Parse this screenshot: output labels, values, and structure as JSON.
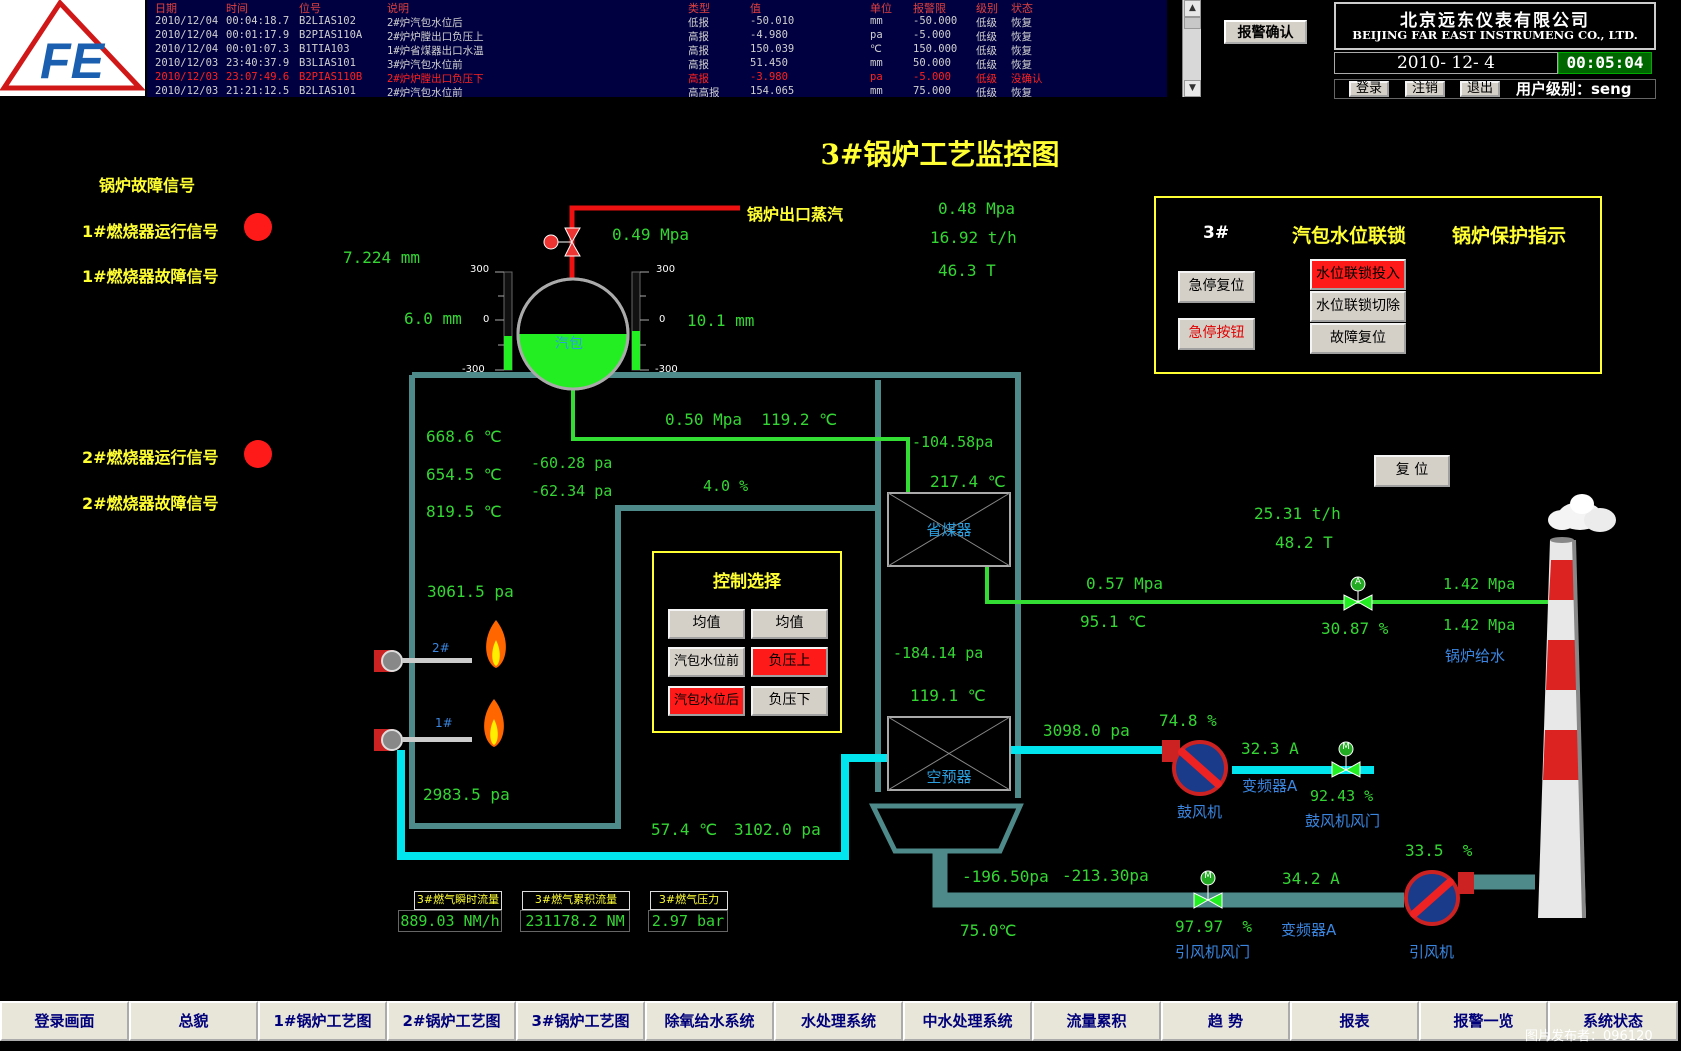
{
  "header": {
    "logo_text": "FE",
    "alarm_columns": [
      "日期",
      "时间",
      "位号",
      "说明",
      "类型",
      "值",
      "单位",
      "报警限",
      "级别",
      "状态"
    ],
    "alarm_rows": [
      {
        "date": "2010/12/04",
        "time": "00:04:18.7",
        "tag": "B2LIAS102",
        "desc": "2#炉汽包水位后",
        "type": "低报",
        "value": "-50.010",
        "unit": "mm",
        "limit": "-50.000",
        "level": "低级",
        "status": "恢复",
        "color": "#d0d0d0"
      },
      {
        "date": "2010/12/04",
        "time": "00:01:17.9",
        "tag": "B2PIAS110A",
        "desc": "2#炉炉膛出口负压上",
        "type": "高报",
        "value": "-4.980",
        "unit": "pa",
        "limit": "-5.000",
        "level": "低级",
        "status": "恢复",
        "color": "#d0d0d0"
      },
      {
        "date": "2010/12/04",
        "time": "00:01:07.3",
        "tag": "B1TIA103",
        "desc": "1#炉省煤器出口水温",
        "type": "高报",
        "value": "150.039",
        "unit": "℃",
        "limit": "150.000",
        "level": "低级",
        "status": "恢复",
        "color": "#d0d0d0"
      },
      {
        "date": "2010/12/03",
        "time": "23:40:37.9",
        "tag": "B3LIAS101",
        "desc": "3#炉汽包水位前",
        "type": "高报",
        "value": "51.450",
        "unit": "mm",
        "limit": "50.000",
        "level": "低级",
        "status": "恢复",
        "color": "#d0d0d0"
      },
      {
        "date": "2010/12/03",
        "time": "23:07:49.6",
        "tag": "B2PIAS110B",
        "desc": "2#炉炉膛出口负压下",
        "type": "高报",
        "value": "-3.980",
        "unit": "pa",
        "limit": "-5.000",
        "level": "低级",
        "status": "没确认",
        "color": "#ff2020"
      },
      {
        "date": "2010/12/03",
        "time": "21:21:12.5",
        "tag": "B2LIAS101",
        "desc": "2#炉汽包水位前",
        "type": "高高报",
        "value": "154.065",
        "unit": "mm",
        "limit": "75.000",
        "level": "低级",
        "status": "恢复",
        "color": "#d0d0d0"
      }
    ],
    "ack_button": "报警确认",
    "company_cn": "北京远东仪表有限公司",
    "company_en": "BEIJING FAR EAST INSTRUMENG CO., LTD.",
    "date": "2010- 12- 4",
    "clock": "00:05:04",
    "login": "登录",
    "logout": "注销",
    "exit": "退出",
    "user_level": "用户级别：seng"
  },
  "title": "3#锅炉工艺监控图",
  "fault_signals": {
    "heading": "锅炉故障信号",
    "b1_run": "1#燃烧器运行信号",
    "b1_fault": "1#燃烧器故障信号",
    "b2_run": "2#燃烧器运行信号",
    "b2_fault": "2#燃烧器故障信号"
  },
  "drum": {
    "label": "汽包",
    "scale_top": "300",
    "scale_mid": "0",
    "scale_bottom": "-300",
    "level_left": "7.224 mm",
    "level_mid_left": "6.0 mm",
    "level_right": "10.1 mm",
    "pressure": "0.49  Mpa",
    "steam_out_label": "锅炉出口蒸汽",
    "left_fill": 0.35,
    "right_fill": 0.4
  },
  "steam_out": {
    "pressure": "0.48  Mpa",
    "flow": "16.92  t/h",
    "total": "46.3  T"
  },
  "protect_panel": {
    "unit": "3#",
    "water_interlock": "汽包水位联锁",
    "boiler_protect": "锅炉保护指示",
    "estop_reset": "急停复位",
    "estop_button": "急停按钮",
    "interlock_on": "水位联锁投入",
    "interlock_off": "水位联锁切除",
    "fault_reset": "故障复位"
  },
  "reset_button": "复 位",
  "furnace": {
    "t1": "668.6 ℃",
    "t2": "654.5 ℃",
    "t3": "819.5 ℃",
    "p_neg1": "-60.28  pa",
    "p_neg2": "-62.34  pa",
    "o2": "4.0 %",
    "p1": "3061.5  pa",
    "p2": "2983.5  pa",
    "steam_line": "0.50 Mpa  119.2 ℃",
    "eco_pressure": "-104.58pa",
    "eco_temp": "217.4 ℃",
    "burner2": "2#",
    "burner1": "1#"
  },
  "control_select": {
    "title": "控制选择",
    "avg1": "均值",
    "avg2": "均值",
    "drum_front": "汽包水位前",
    "neg_up": "负压上",
    "drum_back": "汽包水位后",
    "neg_down": "负压下"
  },
  "economizer": {
    "label": "省煤器"
  },
  "preheater": {
    "label": "空预器",
    "pressure": "-184.14 pa",
    "temp": "119.1 ℃"
  },
  "feedwater": {
    "p_in": "0.57  Mpa",
    "t_in": "95.1 ℃",
    "flow": "25.31 t/h",
    "total": "48.2  T",
    "valve": "30.87 %",
    "p_out1": "1.42 Mpa",
    "p_out2": "1.42 Mpa",
    "label": "锅炉给水",
    "valve_tag": "A"
  },
  "blower": {
    "pressure": "3098.0  pa",
    "damper_pct": "74.8 %",
    "current": "32.3  A",
    "vfd": "变频器A",
    "fan": "鼓风机",
    "outlet_pct": "92.43 %",
    "outlet_label": "鼓风机风门",
    "valve_tag": "M"
  },
  "air_line": {
    "temp": "57.4 ℃",
    "pressure": "3102.0 pa"
  },
  "induced": {
    "p1": "-196.50pa",
    "p2": "-213.30pa",
    "temp": "75.0℃",
    "damper_pct": "97.97  %",
    "damper_label": "引风机风门",
    "current": "34.2  A",
    "vfd": "变频器A",
    "pct": "33.5  %",
    "fan": "引风机",
    "valve_tag": "M"
  },
  "gas": {
    "inst_label": "3#燃气瞬时流量",
    "inst_value": "889.03 NM/h",
    "total_label": "3#燃气累积流量",
    "total_value": "231178.2 NM",
    "press_label": "3#燃气压力",
    "press_value": "2.97 bar"
  },
  "nav": [
    "登录画面",
    "总貌",
    "1#锅炉工艺图",
    "2#锅炉工艺图",
    "3#锅炉工艺图",
    "除氧给水系统",
    "水处理系统",
    "中水处理系统",
    "流量累积",
    "趋  势",
    "报表",
    "报警一览",
    "系统状态"
  ],
  "watermark": "图片发布者：096120",
  "colors": {
    "pipe_gray": "#4f8a8a",
    "pipe_cyan": "#00e5ee",
    "pipe_green": "#33dd33",
    "pipe_red": "#ee1111",
    "water_green": "#22ee22",
    "text_green": "#34d634",
    "text_yellow": "#ffff33",
    "text_blue": "#3a86e0"
  }
}
